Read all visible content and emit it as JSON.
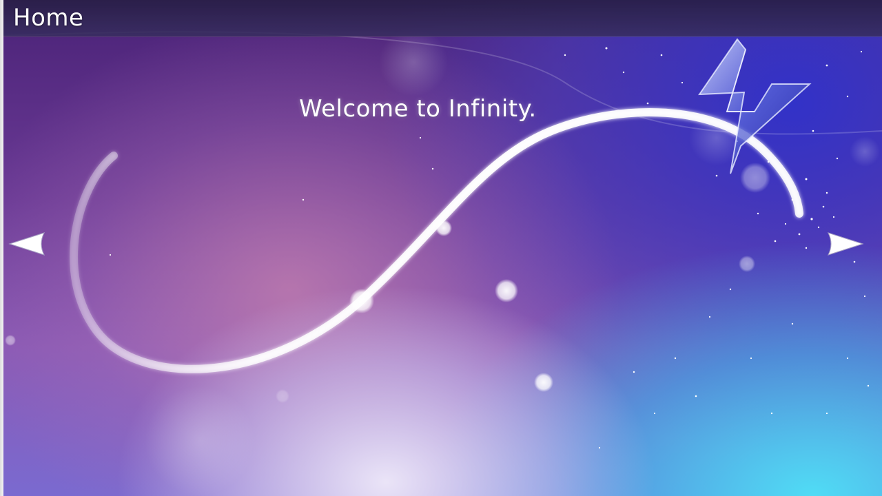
{
  "header": {
    "title": "Home"
  },
  "main": {
    "welcome_text": "Welcome to Infinity."
  },
  "nav": {
    "left_arrow_icon": "arrow-left-icon",
    "right_arrow_icon": "arrow-right-icon"
  },
  "logo": {
    "icon": "infinity-logo-icon"
  },
  "colors": {
    "top_bar": "#2e2450",
    "background_purple": "#6a3a95",
    "background_blue": "#3a3ac8",
    "background_cyan": "#40c8f0",
    "text": "#ffffff"
  }
}
